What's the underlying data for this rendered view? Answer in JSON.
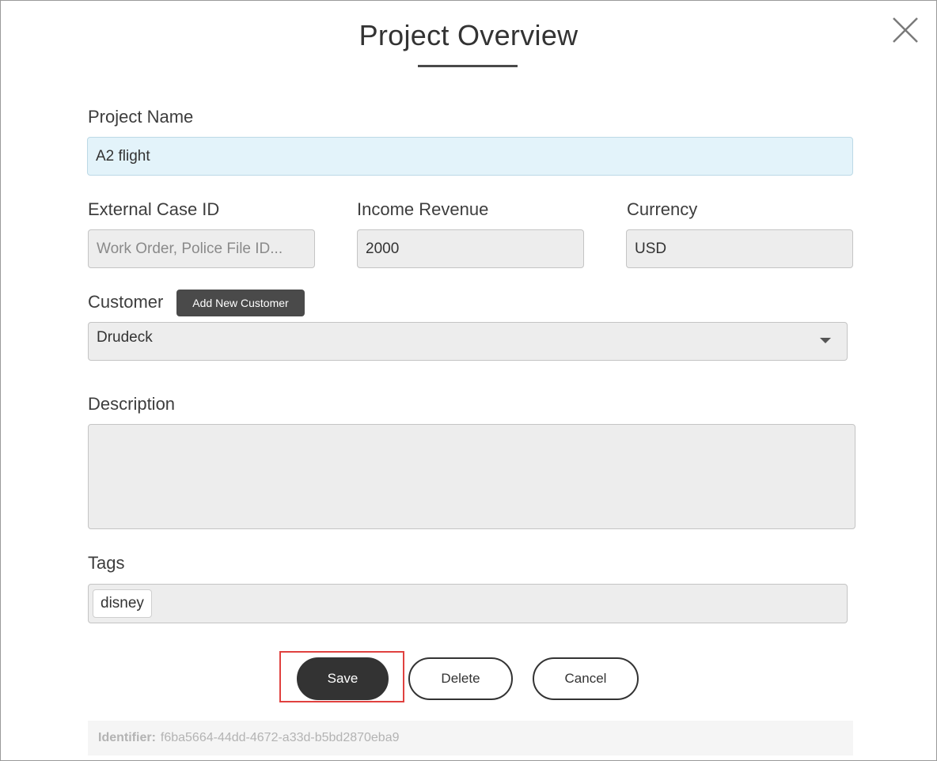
{
  "dialog": {
    "title": "Project Overview"
  },
  "form": {
    "project_name": {
      "label": "Project Name",
      "value": "A2 flight"
    },
    "external_case_id": {
      "label": "External Case ID",
      "value": "",
      "placeholder": "Work Order, Police File ID..."
    },
    "income_revenue": {
      "label": "Income Revenue",
      "value": "2000"
    },
    "currency": {
      "label": "Currency",
      "value": "USD"
    },
    "customer": {
      "label": "Customer",
      "add_button_label": "Add New Customer",
      "selected": "Drudeck"
    },
    "description": {
      "label": "Description",
      "value": ""
    },
    "tags": {
      "label": "Tags",
      "items": [
        "disney"
      ]
    }
  },
  "actions": {
    "save_label": "Save",
    "delete_label": "Delete",
    "cancel_label": "Cancel"
  },
  "footer": {
    "identifier_key": "Identifier:",
    "identifier_value": "f6ba5664-44dd-4672-a33d-b5bd2870eba9"
  },
  "icons": {
    "close": "close-icon",
    "dropdown": "chevron-down-icon"
  },
  "colors": {
    "primary_button": "#333333",
    "highlight_field": "#e3f3fa",
    "focus_outline": "#e0413f"
  }
}
